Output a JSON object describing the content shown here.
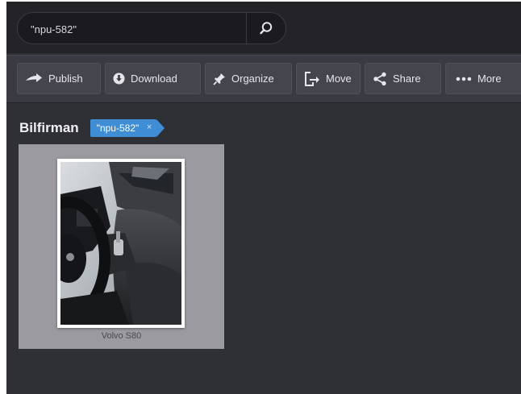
{
  "search": {
    "value": "\"npu-582\"",
    "icon": "search-icon"
  },
  "toolbar": {
    "publish": {
      "label": "Publish",
      "icon": "arrow-right-icon"
    },
    "download": {
      "label": "Download",
      "icon": "download-icon"
    },
    "organize": {
      "label": "Organize",
      "icon": "pin-icon"
    },
    "move": {
      "label": "Move",
      "icon": "move-icon"
    },
    "share": {
      "label": "Share",
      "icon": "share-icon"
    },
    "more": {
      "label": "More",
      "icon": "dots-icon"
    }
  },
  "content": {
    "title": "Bilfirman",
    "filter_tag": "\"npu-582\"",
    "filter_tag_remove": "×"
  },
  "items": [
    {
      "caption": "Volvo S80"
    }
  ],
  "colors": {
    "background": "#2f2f36",
    "toolbar": "#3a3a42",
    "tag": "#3f8dd4",
    "tile": "#9a9aa0"
  }
}
